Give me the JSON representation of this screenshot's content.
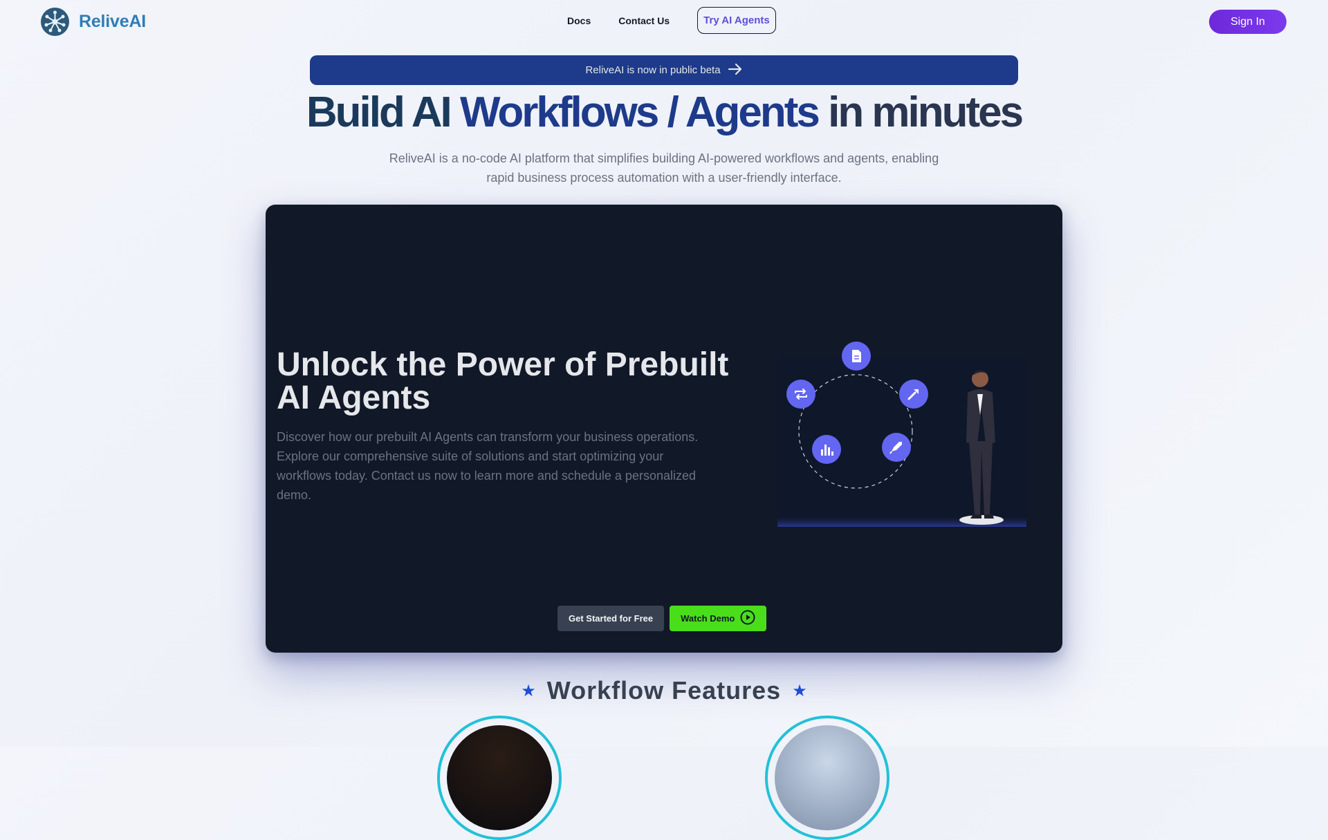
{
  "nav": {
    "brand": "ReliveAI",
    "links": [
      "Docs",
      "Contact Us"
    ],
    "cta": "Try AI Agents",
    "signin": "Sign In"
  },
  "banner": {
    "text": "ReliveAI is now in public beta",
    "icon": "arrow-right-icon"
  },
  "hero": {
    "title_part1": "Build AI",
    "title_part2": "Workflows / Agents",
    "title_part3": "in minutes",
    "subtitle": "ReliveAI is a no-code AI platform that simplifies building AI-powered workflows and agents, enabling rapid business process automation with a user-friendly interface."
  },
  "card": {
    "title": "Unlock the Power of Prebuilt AI Agents",
    "text": "Discover how our prebuilt AI Agents can transform your business operations. Explore our comprehensive suite of solutions and start optimizing your workflows today. Contact us now to learn more and schedule a personalized demo.",
    "illustration_icons": [
      "document-icon",
      "build-icon",
      "rocket-icon",
      "bar-chart-icon",
      "repeat-icon"
    ],
    "buttons": {
      "start": "Get Started for Free",
      "demo": "Watch Demo"
    }
  },
  "features": {
    "title": "Workflow Features"
  },
  "colors": {
    "accent_purple": "#6d28d9",
    "banner_blue": "#1e3a8a",
    "card_bg": "#111827",
    "demo_green": "#4ade1a",
    "icon_indigo": "#6366f1"
  }
}
